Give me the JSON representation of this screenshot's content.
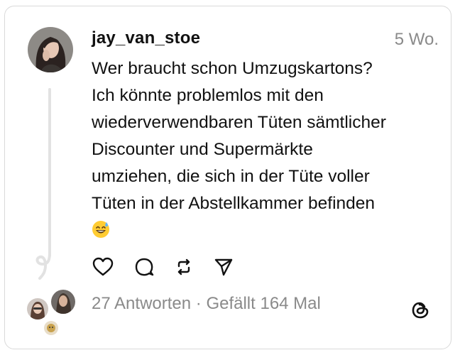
{
  "post": {
    "username": "jay_van_stoe",
    "timestamp": "5 Wo.",
    "text_lines": [
      "Wer braucht schon Umzugskartons?",
      "Ich könnte problemlos mit den",
      "wiederverwendbaren Tüten sämtlicher",
      "Discounter und Supermärkte",
      "umziehen, die sich in der Tüte voller",
      "Tüten in der Abstellkammer befinden"
    ],
    "emoji": "grinning-face-with-sweat"
  },
  "stats": {
    "replies": "27 Antworten",
    "separator": " · ",
    "likes": "Gefällt 164 Mal"
  },
  "icons": {
    "like": "heart-icon",
    "reply": "comment-icon",
    "repost": "repost-icon",
    "share": "send-icon",
    "brand": "threads-logo-icon"
  },
  "colors": {
    "text": "#111111",
    "muted": "#8a8a8a",
    "border": "#d9d9d9"
  }
}
